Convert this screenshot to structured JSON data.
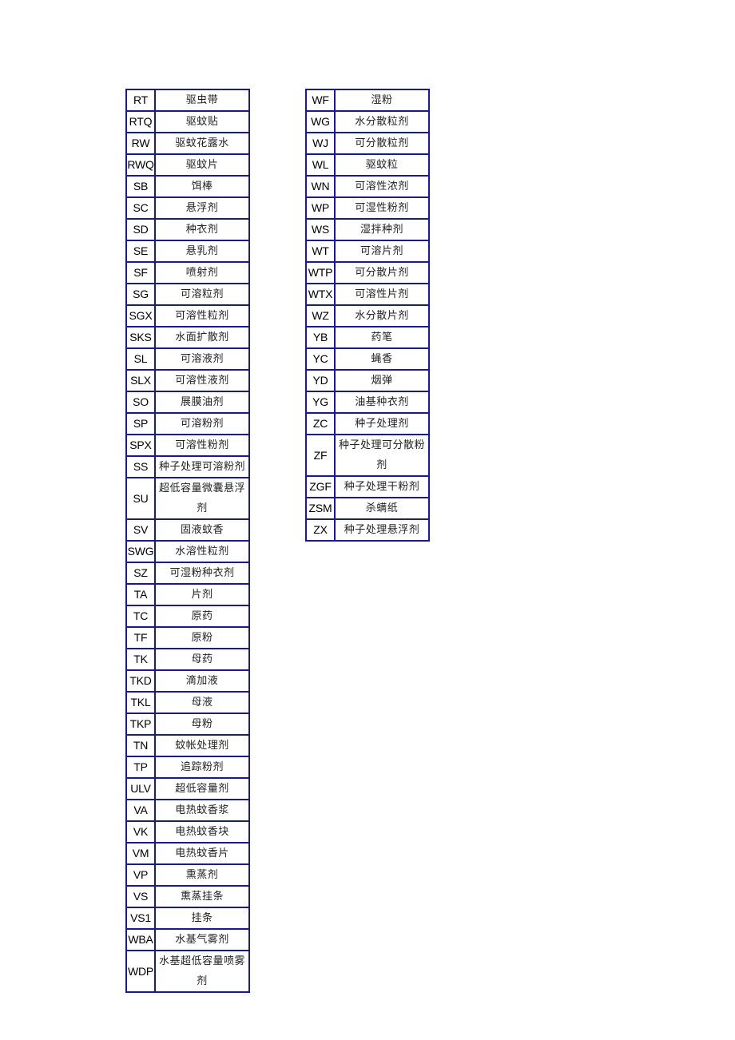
{
  "left_table": {
    "rows": [
      {
        "code": "RT",
        "name": "驱虫带"
      },
      {
        "code": "RTQ",
        "name": "驱蚊贴"
      },
      {
        "code": "RW",
        "name": "驱蚊花露水"
      },
      {
        "code": "RWQ",
        "name": "驱蚊片"
      },
      {
        "code": "SB",
        "name": "饵棒"
      },
      {
        "code": "SC",
        "name": "悬浮剂"
      },
      {
        "code": "SD",
        "name": "种衣剂"
      },
      {
        "code": "SE",
        "name": "悬乳剂"
      },
      {
        "code": "SF",
        "name": "喷射剂"
      },
      {
        "code": "SG",
        "name": "可溶粒剂"
      },
      {
        "code": "SGX",
        "name": "可溶性粒剂"
      },
      {
        "code": "SKS",
        "name": "水面扩散剂"
      },
      {
        "code": "SL",
        "name": "可溶液剂"
      },
      {
        "code": "SLX",
        "name": "可溶性液剂"
      },
      {
        "code": "SO",
        "name": "展膜油剂"
      },
      {
        "code": "SP",
        "name": "可溶粉剂"
      },
      {
        "code": "SPX",
        "name": "可溶性粉剂"
      },
      {
        "code": "SS",
        "name": "种子处理可溶粉剂"
      },
      {
        "code": "SU",
        "name": "超低容量微囊悬浮剂",
        "tall": true
      },
      {
        "code": "SV",
        "name": "固液蚊香"
      },
      {
        "code": "SWG",
        "name": "水溶性粒剂"
      },
      {
        "code": "SZ",
        "name": "可湿粉种衣剂"
      },
      {
        "code": "TA",
        "name": "片剂"
      },
      {
        "code": "TC",
        "name": "原药"
      },
      {
        "code": "TF",
        "name": "原粉"
      },
      {
        "code": "TK",
        "name": "母药"
      },
      {
        "code": "TKD",
        "name": "滴加液"
      },
      {
        "code": "TKL",
        "name": "母液"
      },
      {
        "code": "TKP",
        "name": "母粉"
      },
      {
        "code": "TN",
        "name": "蚊帐处理剂"
      },
      {
        "code": "TP",
        "name": "追踪粉剂"
      },
      {
        "code": "ULV",
        "name": "超低容量剂"
      },
      {
        "code": "VA",
        "name": "电热蚊香浆"
      },
      {
        "code": "VK",
        "name": "电热蚊香块"
      },
      {
        "code": "VM",
        "name": "电热蚊香片"
      },
      {
        "code": "VP",
        "name": "熏蒸剂"
      },
      {
        "code": "VS",
        "name": "熏蒸挂条"
      },
      {
        "code": "VS1",
        "name": "挂条"
      },
      {
        "code": "WBA",
        "name": "水基气雾剂"
      },
      {
        "code": "WDP",
        "name": "水基超低容量喷雾剂",
        "tall": true
      }
    ]
  },
  "right_table": {
    "rows": [
      {
        "code": "WF",
        "name": "湿粉"
      },
      {
        "code": "WG",
        "name": "水分散粒剂"
      },
      {
        "code": "WJ",
        "name": "可分散粒剂"
      },
      {
        "code": "WL",
        "name": "驱蚊粒"
      },
      {
        "code": "WN",
        "name": "可溶性浓剂"
      },
      {
        "code": "WP",
        "name": "可湿性粉剂"
      },
      {
        "code": "WS",
        "name": "湿拌种剂"
      },
      {
        "code": "WT",
        "name": "可溶片剂"
      },
      {
        "code": "WTP",
        "name": "可分散片剂"
      },
      {
        "code": "WTX",
        "name": "可溶性片剂"
      },
      {
        "code": "WZ",
        "name": "水分散片剂"
      },
      {
        "code": "YB",
        "name": "药笔"
      },
      {
        "code": "YC",
        "name": "蝇香"
      },
      {
        "code": "YD",
        "name": "烟弹"
      },
      {
        "code": "YG",
        "name": "油基种衣剂"
      },
      {
        "code": "ZC",
        "name": "种子处理剂"
      },
      {
        "code": "ZF",
        "name": "种子处理可分散粉剂",
        "tall": true
      },
      {
        "code": "ZGF",
        "name": "种子处理干粉剂"
      },
      {
        "code": "ZSM",
        "name": "杀螨纸"
      },
      {
        "code": "ZX",
        "name": "种子处理悬浮剂"
      }
    ]
  }
}
